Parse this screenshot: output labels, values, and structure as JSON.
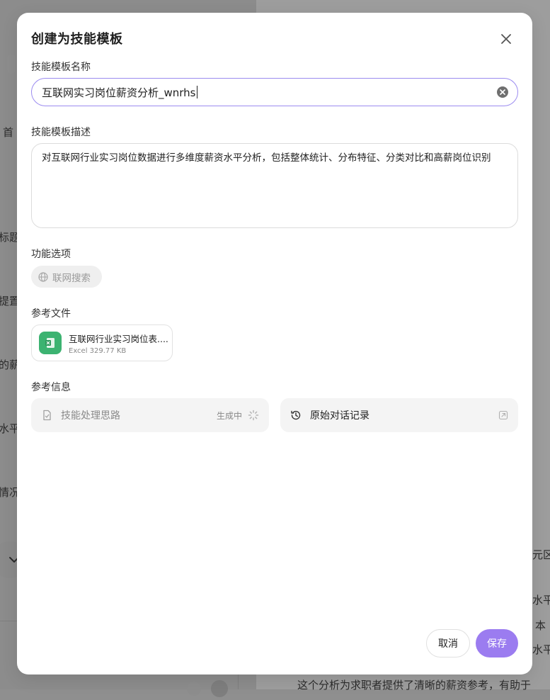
{
  "background": {
    "left_fragments": [
      "首",
      "标题。",
      "提置",
      "的薪",
      "水平",
      "情况"
    ],
    "right_fragments": [
      "元区",
      "水平",
      "本",
      "水平"
    ],
    "bottom_text": "这个分析为求职者提供了清晰的薪资参考，有助于"
  },
  "modal": {
    "title": "创建为技能模板",
    "name_label": "技能模板名称",
    "name_value": "互联网实习岗位薪资分析_wnrhs",
    "desc_label": "技能模板描述",
    "desc_value": "对互联网行业实习岗位数据进行多维度薪资水平分析，包括整体统计、分布特征、分类对比和高薪岗位识别",
    "options_label": "功能选项",
    "web_search_label": "联网搜索",
    "files_label": "参考文件",
    "file": {
      "name": "互联网行业实习岗位表....",
      "meta": "Excel 329.77 KB"
    },
    "ref_info_label": "参考信息",
    "skill_process_label": "技能处理思路",
    "skill_process_status": "生成中",
    "chat_history_label": "原始对话记录",
    "cancel_label": "取消",
    "save_label": "保存"
  },
  "colors": {
    "accent": "#9b7cf0",
    "input_focus_border": "#9b8bf0",
    "excel_green": "#3cb371"
  },
  "icons": [
    "close-icon",
    "clear-icon",
    "globe-icon",
    "excel-icon",
    "document-icon",
    "spinner-icon",
    "history-icon",
    "open-external-icon",
    "chevron-down-icon"
  ]
}
